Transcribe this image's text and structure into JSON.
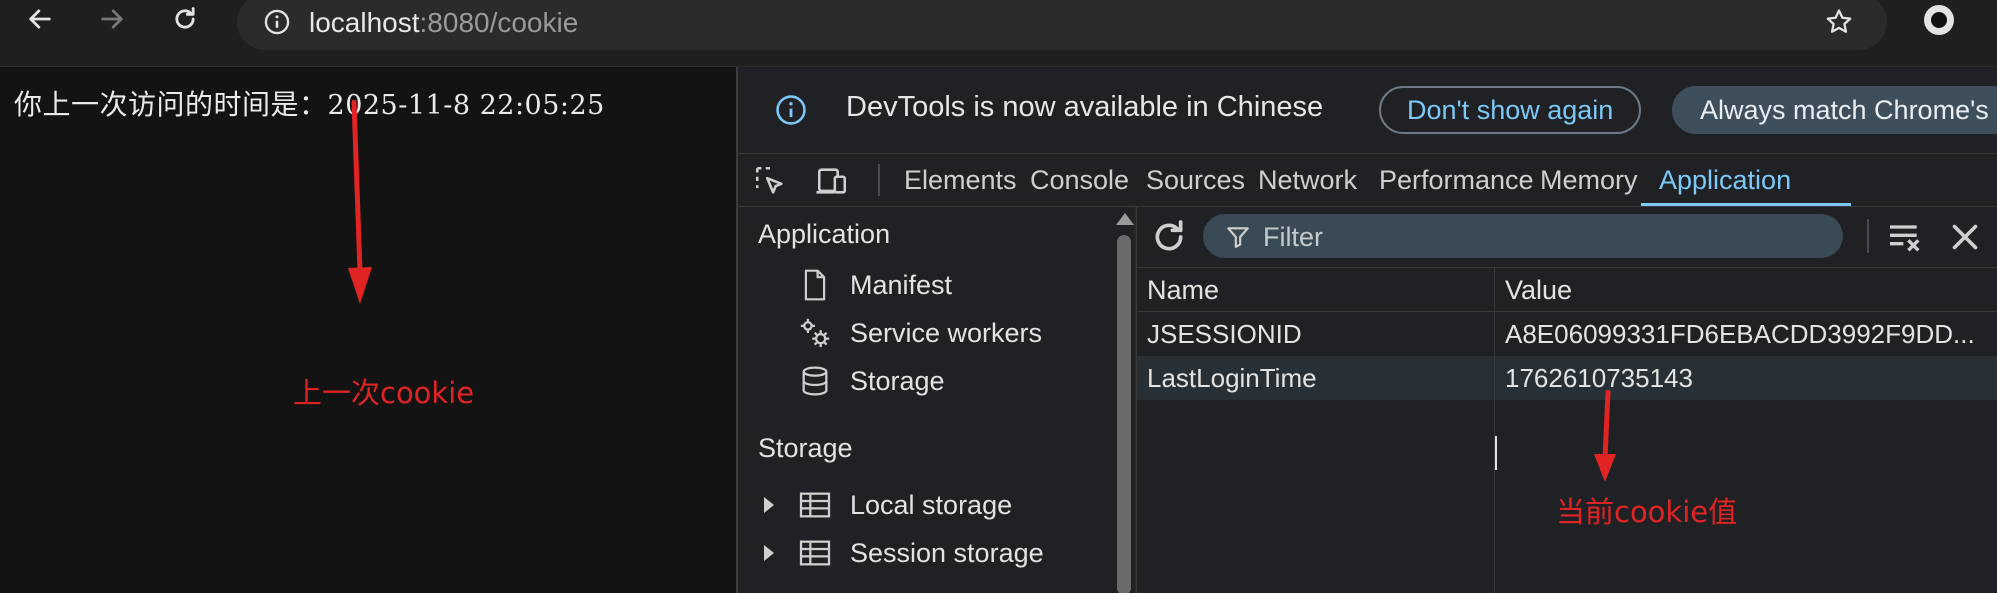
{
  "browser": {
    "url_host": "localhost",
    "url_rest": ":8080/cookie"
  },
  "page": {
    "label": "你上一次访问的时间是：",
    "time": "2025-11-8 22:05:25"
  },
  "devtools": {
    "infobar": {
      "message": "DevTools is now available in Chinese",
      "dont_show": "Don't show again",
      "always_match": "Always match Chrome's"
    },
    "tabs": [
      "Elements",
      "Console",
      "Sources",
      "Network",
      "Performance",
      "Memory",
      "Application"
    ],
    "active_tab": "Application",
    "sidebar": {
      "application_header": "Application",
      "application_items": [
        "Manifest",
        "Service workers",
        "Storage"
      ],
      "storage_header": "Storage",
      "storage_items": [
        "Local storage",
        "Session storage"
      ]
    },
    "filter_placeholder": "Filter",
    "table": {
      "columns": [
        "Name",
        "Value"
      ],
      "rows": [
        {
          "name": "JSESSIONID",
          "value": "A8E06099331FD6EBACDD3992F9DD..."
        },
        {
          "name": "LastLoginTime",
          "value": "1762610735143"
        }
      ]
    }
  },
  "annotations": {
    "previous_cookie": "上一次cookie",
    "current_cookie_value": "当前cookie值",
    "color": "#e02424"
  },
  "colors": {
    "accent": "#7cc8f8",
    "background": "#131313"
  }
}
